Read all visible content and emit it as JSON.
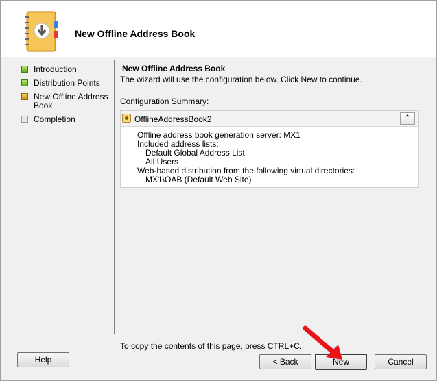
{
  "header": {
    "title": "New Offline Address Book"
  },
  "nav": {
    "items": [
      {
        "label": "Introduction",
        "state": "done"
      },
      {
        "label": "Distribution Points",
        "state": "done"
      },
      {
        "label": "New Offline Address Book",
        "state": "current"
      },
      {
        "label": "Completion",
        "state": "pending"
      }
    ]
  },
  "content": {
    "heading": "New Offline Address Book",
    "description": "The wizard will use the configuration below.  Click New to continue.",
    "summary_label": "Configuration Summary:",
    "summary": {
      "name": "OfflineAddressBook2",
      "collapse_glyph": "⌃",
      "lines": {
        "server": "Offline address book generation server: MX1",
        "lists_label": "Included address lists:",
        "list1": "Default Global Address List",
        "list2": "All Users",
        "web_label": "Web-based distribution from the following virtual directories:",
        "web1": "MX1\\OAB (Default Web Site)"
      }
    }
  },
  "footer": {
    "copy_hint": "To copy the contents of this page, press CTRL+C.",
    "help_label": "Help",
    "back_label": "< Back",
    "new_label": "New",
    "cancel_label": "Cancel"
  },
  "colors": {
    "arrow": "#e8141a",
    "step_done": "#5fae1e",
    "step_current": "#e0a820"
  }
}
